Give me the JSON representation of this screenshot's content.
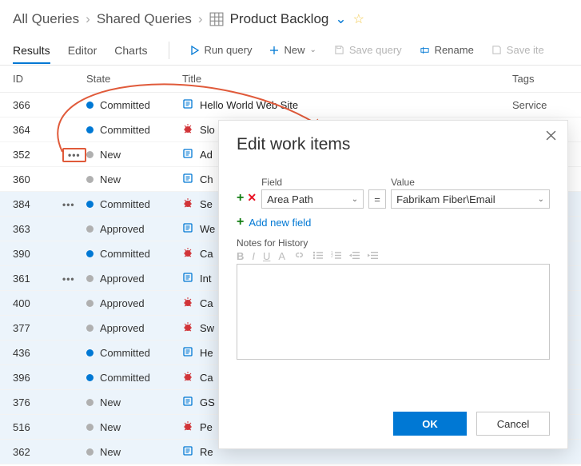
{
  "breadcrumb": {
    "root": "All Queries",
    "mid": "Shared Queries",
    "leaf": "Product Backlog"
  },
  "tabs": {
    "results": "Results",
    "editor": "Editor",
    "charts": "Charts"
  },
  "toolbar": {
    "run": "Run query",
    "new": "New",
    "save": "Save query",
    "rename": "Rename",
    "saveitems": "Save ite"
  },
  "columns": {
    "id": "ID",
    "state": "State",
    "title": "Title",
    "tags": "Tags"
  },
  "rows": [
    {
      "id": "366",
      "dots": "",
      "state": "Committed",
      "dot": "blue",
      "icon": "book-blue",
      "title": "Hello World Web Site",
      "sel": false,
      "tags": "Service"
    },
    {
      "id": "364",
      "dots": "",
      "state": "Committed",
      "dot": "blue",
      "icon": "bug-red",
      "title": "Slo",
      "sel": false,
      "tags": ""
    },
    {
      "id": "352",
      "dots": "box",
      "state": "New",
      "dot": "gray",
      "icon": "book-blue",
      "title": "Ad",
      "sel": false,
      "tags": ""
    },
    {
      "id": "360",
      "dots": "",
      "state": "New",
      "dot": "gray",
      "icon": "book-blue",
      "title": "Ch",
      "sel": false,
      "tags": ""
    },
    {
      "id": "384",
      "dots": "…",
      "state": "Committed",
      "dot": "blue",
      "icon": "bug-red",
      "title": "Se",
      "sel": true,
      "tags": ""
    },
    {
      "id": "363",
      "dots": "",
      "state": "Approved",
      "dot": "gray",
      "icon": "book-blue",
      "title": "We",
      "sel": true,
      "tags": ""
    },
    {
      "id": "390",
      "dots": "",
      "state": "Committed",
      "dot": "blue",
      "icon": "bug-red",
      "title": "Ca",
      "sel": true,
      "tags": ""
    },
    {
      "id": "361",
      "dots": "…",
      "state": "Approved",
      "dot": "gray",
      "icon": "book-blue",
      "title": "Int",
      "sel": true,
      "tags": ""
    },
    {
      "id": "400",
      "dots": "",
      "state": "Approved",
      "dot": "gray",
      "icon": "bug-red",
      "title": "Ca",
      "sel": true,
      "tags": ""
    },
    {
      "id": "377",
      "dots": "",
      "state": "Approved",
      "dot": "gray",
      "icon": "bug-red",
      "title": "Sw",
      "sel": true,
      "tags": ""
    },
    {
      "id": "436",
      "dots": "",
      "state": "Committed",
      "dot": "blue",
      "icon": "book-blue",
      "title": "He",
      "sel": true,
      "tags": ""
    },
    {
      "id": "396",
      "dots": "",
      "state": "Committed",
      "dot": "blue",
      "icon": "bug-red",
      "title": "Ca",
      "sel": true,
      "tags": ""
    },
    {
      "id": "376",
      "dots": "",
      "state": "New",
      "dot": "gray",
      "icon": "book-blue",
      "title": "GS",
      "sel": true,
      "tags": ""
    },
    {
      "id": "516",
      "dots": "",
      "state": "New",
      "dot": "gray",
      "icon": "bug-red",
      "title": "Pe",
      "sel": true,
      "tags": ""
    },
    {
      "id": "362",
      "dots": "",
      "state": "New",
      "dot": "gray",
      "icon": "book-blue",
      "title": "Re",
      "sel": true,
      "tags": ""
    }
  ],
  "dialog": {
    "title": "Edit work items",
    "field_label": "Field",
    "value_label": "Value",
    "field_value": "Area Path",
    "operator": "=",
    "value_value": "Fabrikam Fiber\\Email",
    "add_field": "Add new field",
    "notes_label": "Notes for History",
    "ok": "OK",
    "cancel": "Cancel"
  }
}
